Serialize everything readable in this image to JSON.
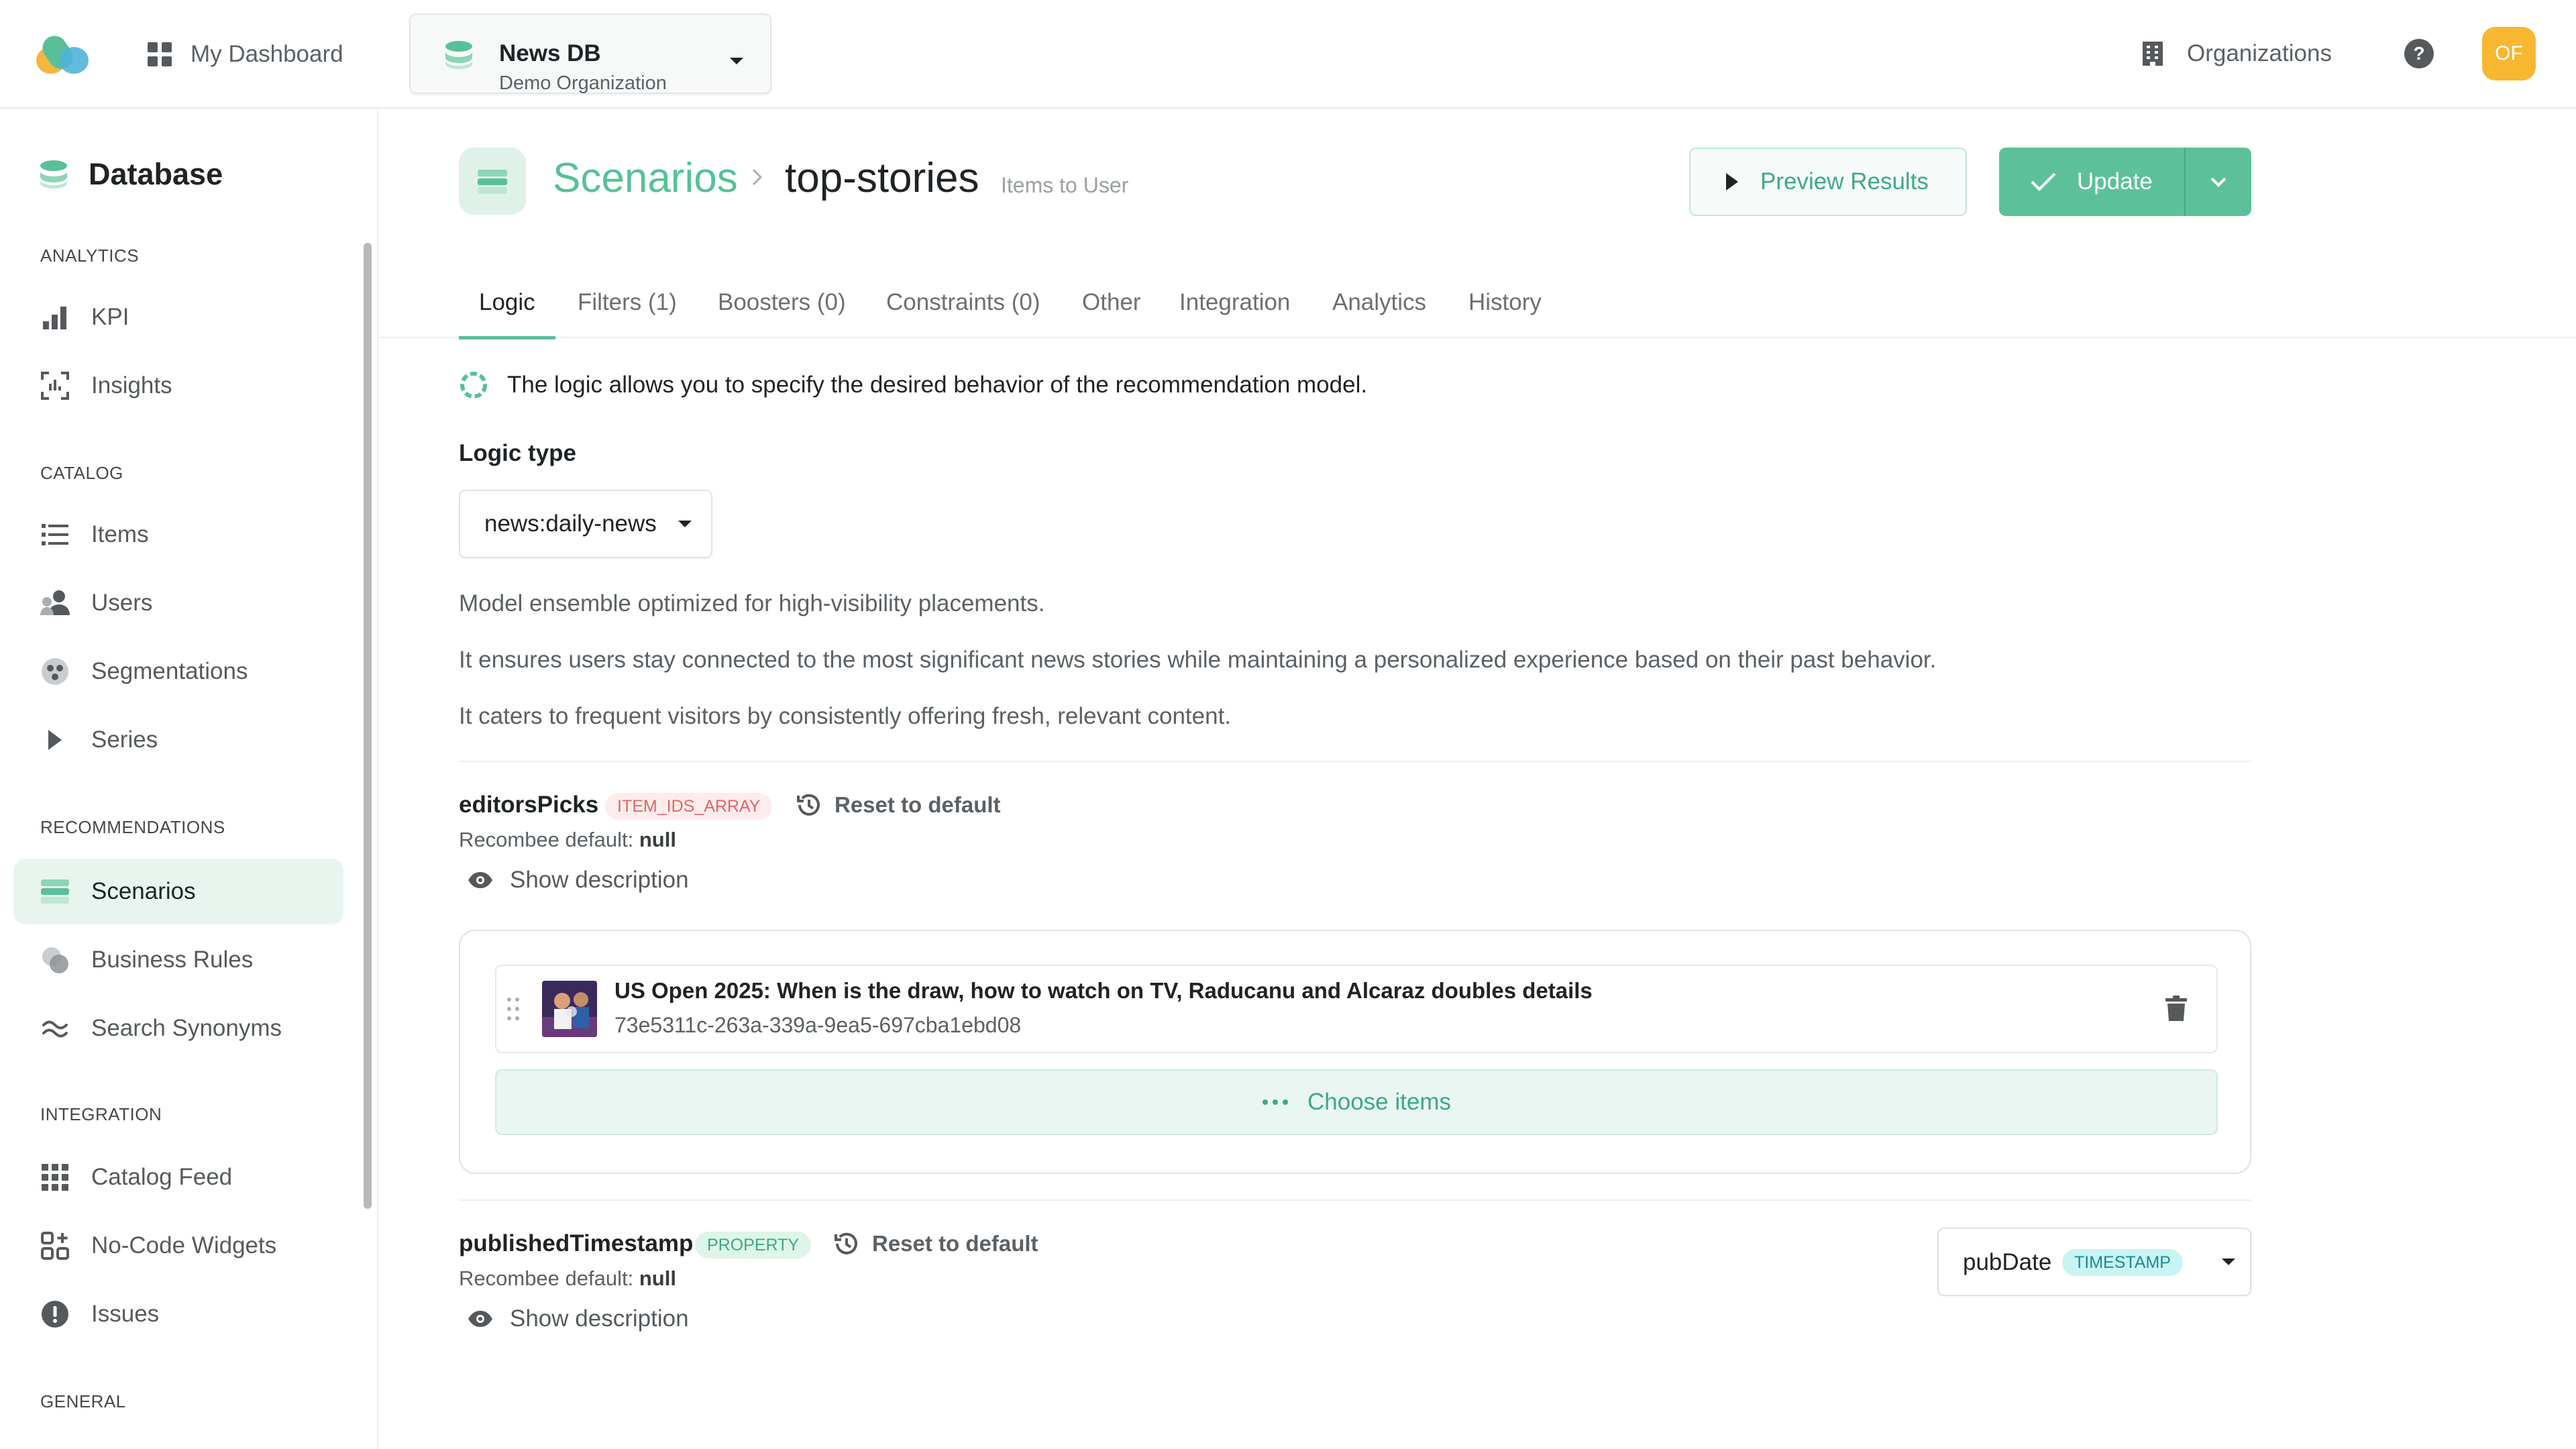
{
  "topbar": {
    "dashboard_label": "My Dashboard",
    "db_name": "News DB",
    "db_org": "Demo Organization",
    "organizations_label": "Organizations",
    "help_label": "?",
    "avatar_initials": "OF"
  },
  "sidebar": {
    "title": "Database",
    "sections": {
      "analytics": "ANALYTICS",
      "catalog": "CATALOG",
      "recommendations": "RECOMMENDATIONS",
      "integration": "INTEGRATION",
      "general": "GENERAL"
    },
    "items": [
      {
        "label": "KPI",
        "icon": "bar-chart-icon"
      },
      {
        "label": "Insights",
        "icon": "insights-icon"
      },
      {
        "label": "Items",
        "icon": "list-icon"
      },
      {
        "label": "Users",
        "icon": "users-icon"
      },
      {
        "label": "Segmentations",
        "icon": "segments-icon"
      },
      {
        "label": "Series",
        "icon": "play-icon"
      },
      {
        "label": "Scenarios",
        "icon": "scenarios-icon",
        "active": true
      },
      {
        "label": "Business Rules",
        "icon": "rules-icon"
      },
      {
        "label": "Search Synonyms",
        "icon": "approx-icon"
      },
      {
        "label": "Catalog Feed",
        "icon": "grid-icon"
      },
      {
        "label": "No-Code Widgets",
        "icon": "widgets-icon"
      },
      {
        "label": "Issues",
        "icon": "alert-icon"
      }
    ]
  },
  "header": {
    "breadcrumb": "Scenarios",
    "title": "top-stories",
    "subtitle": "Items to User",
    "preview_label": "Preview Results",
    "update_label": "Update"
  },
  "tabs": [
    {
      "label": "Logic",
      "active": true
    },
    {
      "label": "Filters (1)"
    },
    {
      "label": "Boosters (0)"
    },
    {
      "label": "Constraints (0)"
    },
    {
      "label": "Other"
    },
    {
      "label": "Integration"
    },
    {
      "label": "Analytics"
    },
    {
      "label": "History"
    }
  ],
  "logic": {
    "info": "The logic allows you to specify the desired behavior of the recommendation model.",
    "type_label": "Logic type",
    "type_value": "news:daily-news",
    "descriptions": [
      "Model ensemble optimized for high-visibility placements.",
      "It ensures users stay connected to the most significant news stories while maintaining a personalized experience based on their past behavior.",
      "It caters to frequent visitors by consistently offering fresh, relevant content."
    ]
  },
  "params": [
    {
      "name": "editorsPicks",
      "tag": "ITEM_IDS_ARRAY",
      "reset_label": "Reset to default",
      "default_label": "Recombee default:",
      "default_value": "null",
      "show_desc_label": "Show description",
      "items": [
        {
          "title": "US Open 2025: When is the draw, how to watch on TV, Raducanu and Alcaraz doubles details",
          "id": "73e5311c-263a-339a-9ea5-697cba1ebd08"
        }
      ],
      "choose_label": "Choose items"
    },
    {
      "name": "publishedTimestamp",
      "tag": "PROPERTY",
      "reset_label": "Reset to default",
      "default_label": "Recombee default:",
      "default_value": "null",
      "show_desc_label": "Show description",
      "select_value": "pubDate",
      "select_tag": "TIMESTAMP"
    }
  ],
  "colors": {
    "accent": "#58c098",
    "accent_dark": "#3daa82",
    "avatar": "#f7b731",
    "tag_red": "#e0676a"
  }
}
